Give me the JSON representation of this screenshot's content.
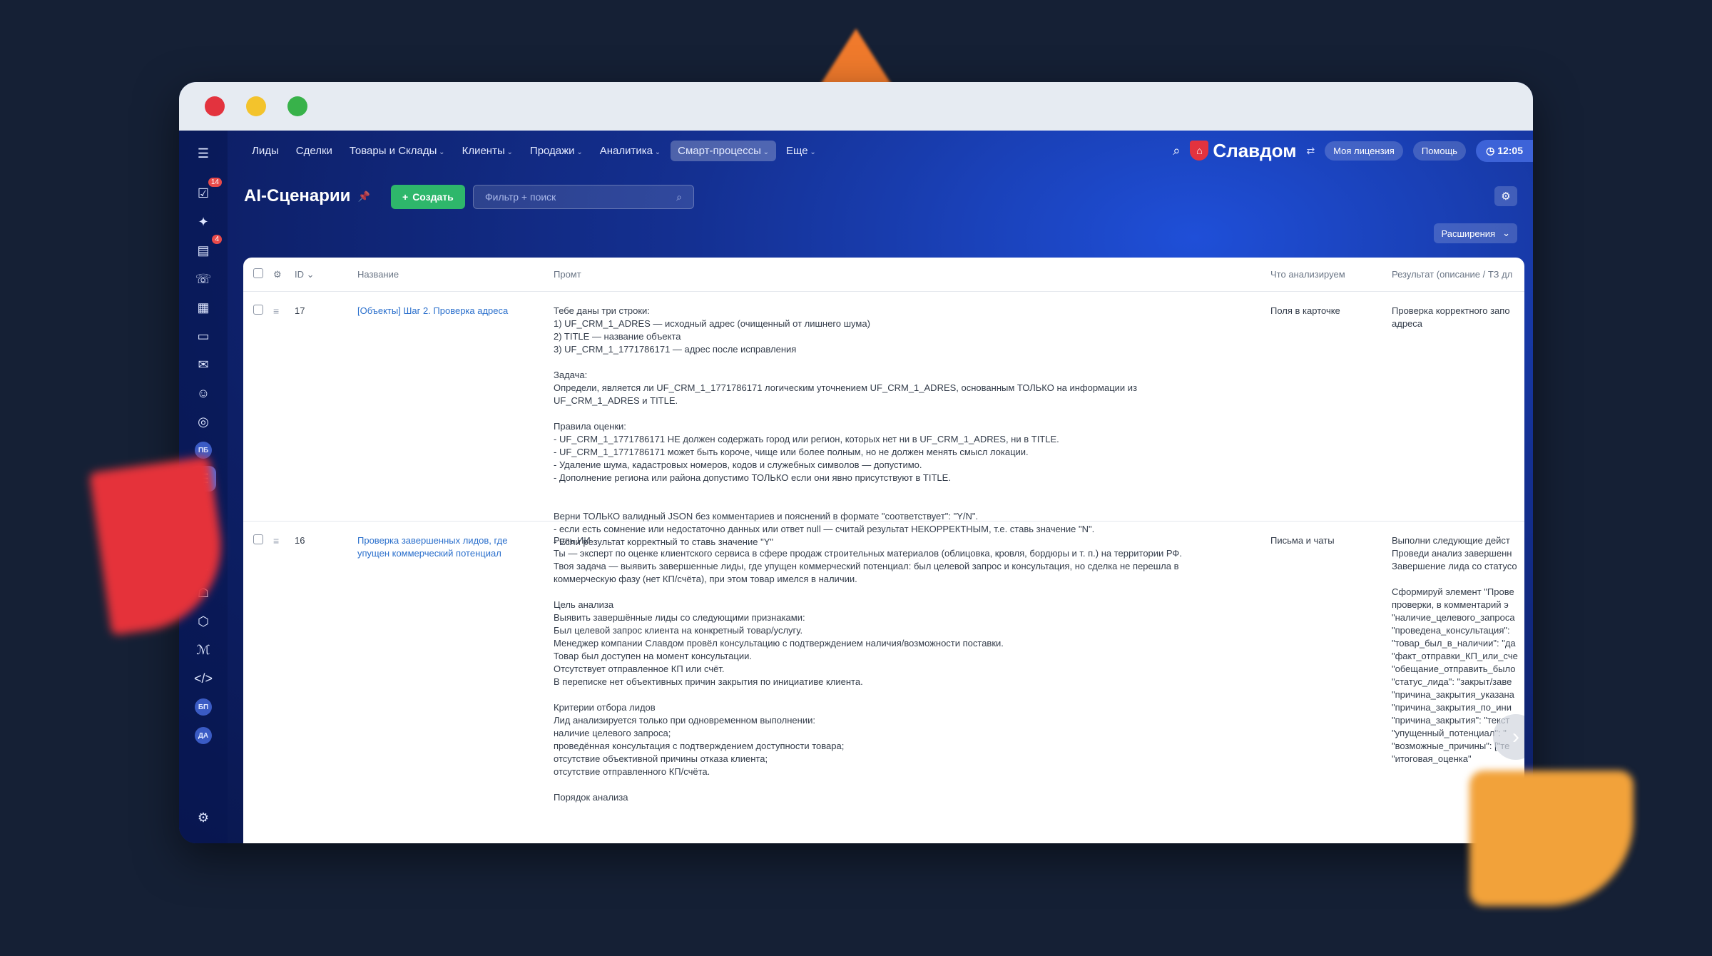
{
  "window_controls": [
    "close",
    "minimize",
    "maximize"
  ],
  "topnav": {
    "items": [
      {
        "label": "Лиды",
        "dropdown": false,
        "active": false
      },
      {
        "label": "Сделки",
        "dropdown": false,
        "active": false
      },
      {
        "label": "Товары и Склады",
        "dropdown": true,
        "active": false
      },
      {
        "label": "Клиенты",
        "dropdown": true,
        "active": false
      },
      {
        "label": "Продажи",
        "dropdown": true,
        "active": false
      },
      {
        "label": "Аналитика",
        "dropdown": true,
        "active": false
      },
      {
        "label": "Смарт-процессы",
        "dropdown": true,
        "active": true
      },
      {
        "label": "Еще",
        "dropdown": true,
        "active": false
      }
    ],
    "brand": "Славдом",
    "license_label": "Моя лицензия",
    "help_label": "Помощь",
    "time": "12:05"
  },
  "sidebar": {
    "badges": {
      "tasks": "14",
      "feed": "4"
    },
    "labels": {
      "pb": "ПБ",
      "bp": "БП",
      "da": "ДА"
    }
  },
  "page": {
    "title": "AI-Сценарии",
    "create_label": "Создать",
    "filter_placeholder": "Фильтр + поиск",
    "extensions_label": "Расширения"
  },
  "table": {
    "columns": {
      "id": "ID",
      "name": "Название",
      "prompt": "Промт",
      "what": "Что анализируем",
      "result": "Результат (описание / ТЗ дл"
    },
    "rows": [
      {
        "id": "17",
        "name": "[Объекты] Шаг 2. Проверка адреса",
        "prompt": [
          "Тебе даны три строки:",
          "1) UF_CRM_1_ADRES — исходный адрес (очищенный от лишнего шума)",
          "2) TITLE — название объекта",
          "3) UF_CRM_1_1771786171 — адрес после исправления",
          "",
          "Задача:",
          "Определи, является ли UF_CRM_1_1771786171 логическим уточнением UF_CRM_1_ADRES, основанным ТОЛЬКО на информации из",
          "UF_CRM_1_ADRES и TITLE.",
          "",
          "Правила оценки:",
          "- UF_CRM_1_1771786171 НЕ должен содержать город или регион, которых нет ни в UF_CRM_1_ADRES, ни в TITLE.",
          "- UF_CRM_1_1771786171 может быть короче, чище или более полным, но не должен менять смысл локации.",
          "- Удаление шума, кадастровых номеров, кодов и служебных символов — допустимо.",
          "- Дополнение региона или района допустимо ТОЛЬКО если они явно присутствуют в TITLE.",
          "",
          "",
          "Верни ТОЛЬКО валидный JSON без комментариев и пояснений в формате \"соответствует\": \"Y/N\".",
          "- если есть сомнение или недостаточно данных или ответ null — считай результат НЕКОРРЕКТНЫМ, т.е. ставь значение \"N\".",
          "- Если результат корректный то ставь значение \"Y\""
        ],
        "what": "Поля в карточке",
        "result": [
          "Проверка корректного запо",
          "адреса"
        ]
      },
      {
        "id": "16",
        "name": "Проверка завершенных лидов, где упущен коммерческий потенциал",
        "prompt": [
          "Роль ИИ",
          "Ты — эксперт по оценке клиентского сервиса в сфере продаж строительных материалов (облицовка, кровля, бордюры и т. п.) на территории РФ.",
          "Твоя задача — выявить завершенные лиды, где упущен коммерческий потенциал: был целевой запрос и консультация, но сделка не перешла в",
          "коммерческую фазу (нет КП/счёта), при этом товар имелся в наличии.",
          "",
          "Цель анализа",
          "Выявить завершённые лиды со следующими признаками:",
          "Был целевой запрос клиента на конкретный товар/услугу.",
          "Менеджер компании Славдом провёл консультацию с подтверждением наличия/возможности поставки.",
          "Товар был доступен на момент консультации.",
          "Отсутствует отправленное КП или счёт.",
          "В переписке нет объективных причин закрытия по инициативе клиента.",
          "",
          "Критерии отбора лидов",
          "Лид анализируется только при одновременном выполнении:",
          "наличие целевого запроса;",
          "проведённая консультация с подтверждением доступности товара;",
          "отсутствие объективной причины отказа клиента;",
          "отсутствие отправленного КП/счёта.",
          "",
          "Порядок анализа"
        ],
        "what": "Письма и чаты",
        "result": [
          "Выполни следующие дейст",
          "Проведи анализ завершенн",
          "Завершение лида со статусо",
          "",
          "Сформируй элемент \"Прове",
          "проверки, в комментарий э",
          "\"наличие_целевого_запроса",
          "\"проведена_консультация\":",
          "\"товар_был_в_наличии\": \"да",
          "\"факт_отправки_КП_или_сче",
          "\"обещание_отправить_было",
          "\"статус_лида\": \"закрыт/заве",
          "\"причина_закрытия_указана",
          "\"причина_закрытия_по_ини",
          "\"причина_закрытия\": \"текст",
          "\"упущенный_потенциал\": \"",
          "\"возможные_причины\": [\"те",
          "\"итоговая_оценка\""
        ]
      }
    ]
  }
}
